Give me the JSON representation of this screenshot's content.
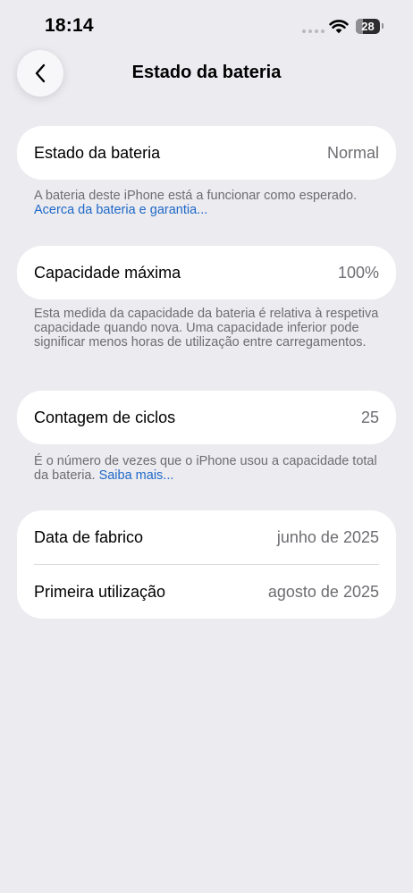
{
  "status_bar": {
    "time": "18:14",
    "battery_level": "28"
  },
  "nav": {
    "title": "Estado da bateria"
  },
  "battery_state": {
    "label": "Estado da bateria",
    "value": "Normal",
    "footnote": "A bateria deste iPhone está a funcionar como esperado.",
    "link": "Acerca da bateria e garantia..."
  },
  "max_capacity": {
    "label": "Capacidade máxima",
    "value": "100%",
    "footnote": "Esta medida da capacidade da bateria é relativa à respetiva capacidade quando nova. Uma capacidade inferior pode significar menos horas de utilização entre carregamentos."
  },
  "cycle_count": {
    "label": "Contagem de ciclos",
    "value": "25",
    "footnote": "É o número de vezes que o iPhone usou a capacidade total da bateria.",
    "link": "Saiba mais..."
  },
  "dates": {
    "manufacture_label": "Data de fabrico",
    "manufacture_value": "junho de 2025",
    "first_use_label": "Primeira utilização",
    "first_use_value": "agosto de 2025"
  },
  "colors": {
    "background": "#ebebf0",
    "card": "#ffffff",
    "link": "#1f68c7",
    "secondary_text": "#6d6d72"
  },
  "icons": {
    "back": "chevron-left-icon",
    "wifi": "wifi-icon",
    "battery": "battery-icon",
    "signal": "cellular-signal-icon"
  }
}
